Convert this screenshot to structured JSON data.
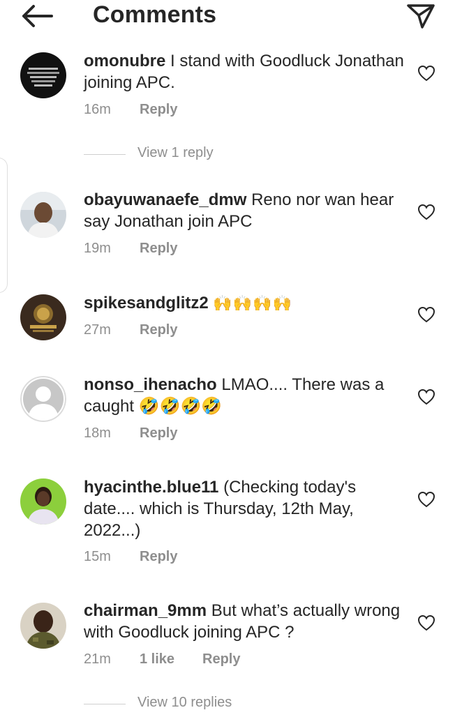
{
  "header": {
    "title": "Comments",
    "back_icon": "arrow-left-icon",
    "share_icon": "paper-plane-icon"
  },
  "comments": [
    {
      "username": "omonubre",
      "text": "I stand with Goodluck Jonathan joining APC.",
      "time": "16m",
      "likes": "",
      "reply_label": "Reply",
      "view_replies": "View 1 reply"
    },
    {
      "username": "obayuwanaefe_dmw",
      "text": "Reno nor wan hear say Jonathan join APC",
      "time": "19m",
      "likes": "",
      "reply_label": "Reply"
    },
    {
      "username": "spikesandglitz2",
      "text": "🙌🙌🙌🙌",
      "time": "27m",
      "likes": "",
      "reply_label": "Reply"
    },
    {
      "username": "nonso_ihenacho",
      "text": "LMAO.... There was a caught 🤣🤣🤣🤣",
      "time": "18m",
      "likes": "",
      "reply_label": "Reply"
    },
    {
      "username": "hyacinthe.blue11",
      "text": "(Checking today's date.... which is Thursday, 12th May, 2022...)",
      "time": "15m",
      "likes": "",
      "reply_label": "Reply"
    },
    {
      "username": "chairman_9mm",
      "text": "But what’s actually wrong with Goodluck joining APC ?",
      "time": "21m",
      "likes": "1 like",
      "reply_label": "Reply",
      "view_replies": "View 10 replies"
    }
  ],
  "colors": {
    "text": "#262626",
    "secondary": "#8e8e8e",
    "background": "#ffffff"
  }
}
